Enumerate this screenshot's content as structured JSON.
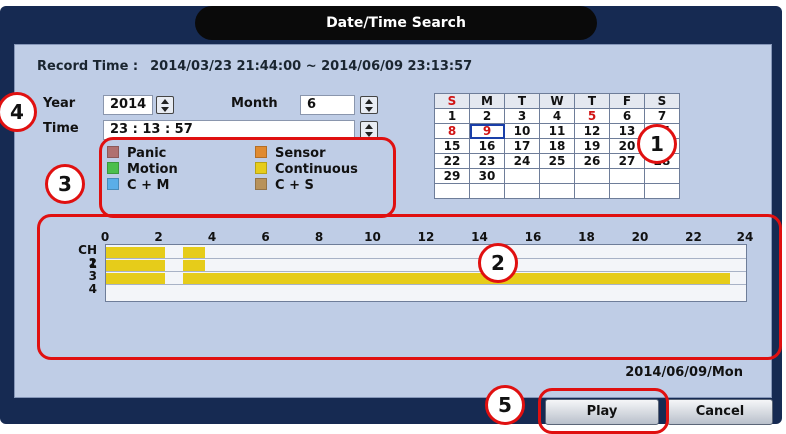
{
  "dialog": {
    "title": "Date/Time Search"
  },
  "record_time": {
    "label": "Record Time :",
    "value": "2014/03/23 21:44:00 ~ 2014/06/09 23:13:57"
  },
  "search": {
    "year_label": "Year",
    "year_value": "2014",
    "month_label": "Month",
    "month_value": "6",
    "time_label": "Time",
    "time_value": "23 : 13 : 57"
  },
  "legend": [
    {
      "label": "Panic",
      "color": "#b07070"
    },
    {
      "label": "Sensor",
      "color": "#e08a30"
    },
    {
      "label": "Motion",
      "color": "#4cbf4c"
    },
    {
      "label": "Continuous",
      "color": "#e6cc1a"
    },
    {
      "label": "C + M",
      "color": "#5aaee8"
    },
    {
      "label": "C + S",
      "color": "#b8925a"
    }
  ],
  "calendar": {
    "headers": [
      "S",
      "M",
      "T",
      "W",
      "T",
      "F",
      "S"
    ],
    "weeks": [
      [
        "1",
        "2",
        "3",
        "4",
        "5",
        "6",
        "7"
      ],
      [
        "8",
        "9",
        "10",
        "11",
        "12",
        "13",
        "14"
      ],
      [
        "15",
        "16",
        "17",
        "18",
        "19",
        "20",
        "21"
      ],
      [
        "22",
        "23",
        "24",
        "25",
        "26",
        "27",
        "28"
      ],
      [
        "29",
        "30",
        "",
        "",
        "",
        "",
        ""
      ],
      [
        "",
        "",
        "",
        "",
        "",
        "",
        ""
      ]
    ],
    "recorded_days": [
      "5",
      "8",
      "9"
    ],
    "selected_day": "9",
    "record_color": "#d11414",
    "selection_color": "#1a3fa8"
  },
  "timeline": {
    "ticks": [
      "0",
      "2",
      "4",
      "6",
      "8",
      "10",
      "12",
      "14",
      "16",
      "18",
      "20",
      "22",
      "24"
    ],
    "channels": [
      "CH 1",
      "2",
      "3",
      "4"
    ],
    "hours": 24,
    "segment_color": "#e6cc1a",
    "segments": [
      {
        "channel": 1,
        "start": 0,
        "end": 2.2
      },
      {
        "channel": 1,
        "start": 2.9,
        "end": 3.7
      },
      {
        "channel": 2,
        "start": 0,
        "end": 2.2
      },
      {
        "channel": 2,
        "start": 2.9,
        "end": 3.7
      },
      {
        "channel": 3,
        "start": 0,
        "end": 2.2
      },
      {
        "channel": 3,
        "start": 2.9,
        "end": 23.4
      }
    ]
  },
  "selected_date": "2014/06/09/Mon",
  "buttons": {
    "play": "Play",
    "cancel": "Cancel"
  },
  "annotations": [
    "1",
    "2",
    "3",
    "4",
    "5"
  ],
  "accent_color": "#e01010"
}
